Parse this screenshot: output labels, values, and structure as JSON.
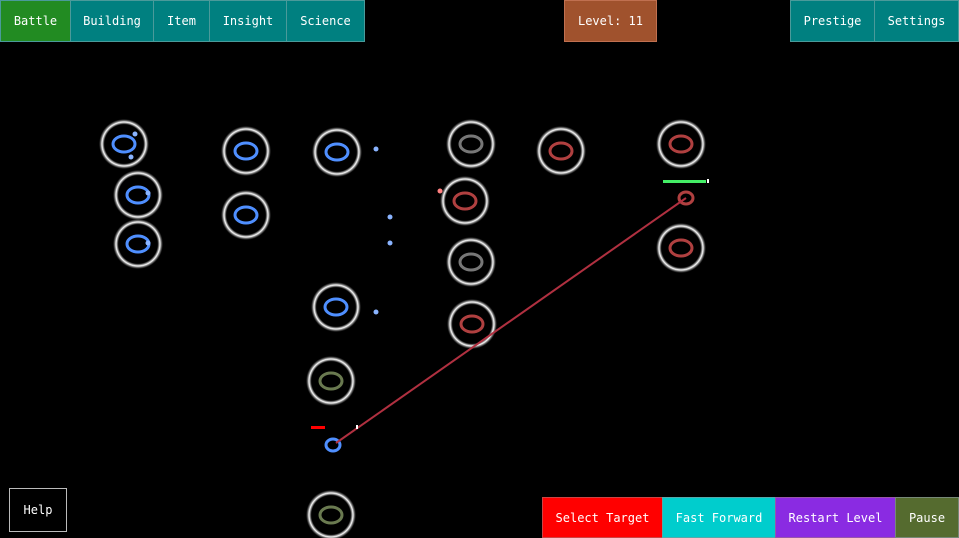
{
  "nav": {
    "tabs": [
      {
        "label": "Battle",
        "color": "#228b22",
        "active": true
      },
      {
        "label": "Building",
        "color": "#008080"
      },
      {
        "label": "Item",
        "color": "#008080"
      },
      {
        "label": "Insight",
        "color": "#008080"
      },
      {
        "label": "Science",
        "color": "#008080"
      }
    ],
    "level_label": "Level: 11",
    "level_color": "#a0522d",
    "prestige_label": "Prestige",
    "settings_label": "Settings"
  },
  "controls": {
    "help_label": "Help",
    "select_target_label": "Select Target",
    "select_target_color": "#ff0000",
    "fast_forward_label": "Fast Forward",
    "fast_forward_color": "#00cdcd",
    "restart_level_label": "Restart Level",
    "restart_level_color": "#8a2be2",
    "pause_label": "Pause",
    "pause_color": "#556b2f"
  },
  "battle": {
    "player_color": "#4f8fff",
    "enemy_color": "#b04040",
    "laser_color": "#b03040",
    "player_health_color": "#ff0000",
    "enemy_health_color": "#44ee66"
  }
}
